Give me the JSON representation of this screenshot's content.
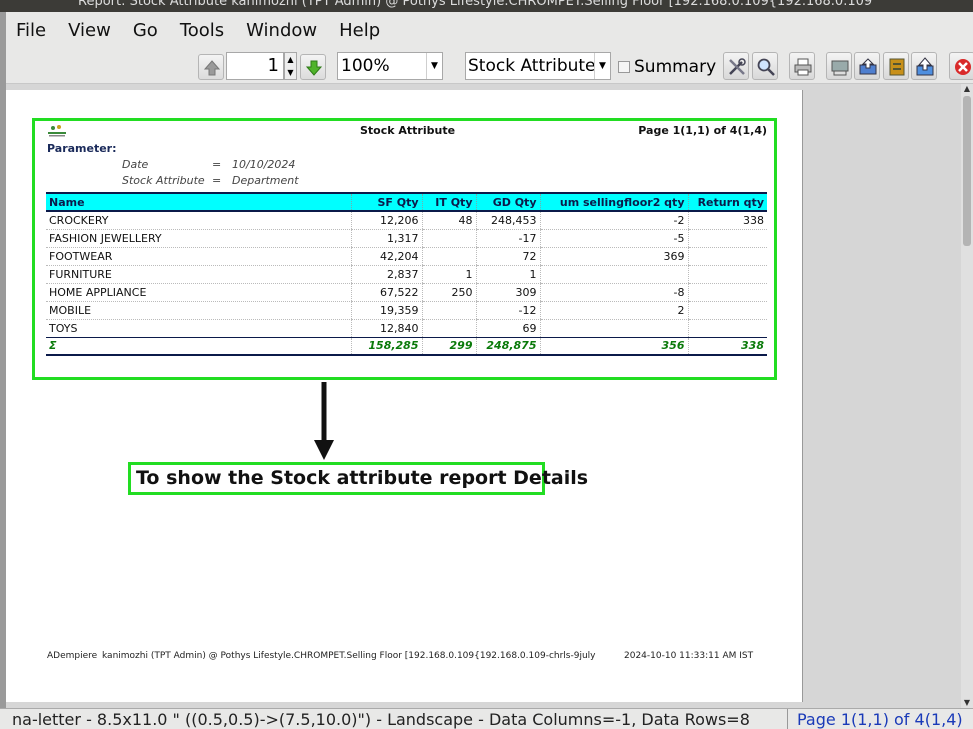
{
  "window": {
    "title": "Report: Stock Attribute  kanimozhi (TPT Admin) @ Pothys Lifestyle.CHROMPET.Selling Floor [192.168.0.109{192.168.0.109"
  },
  "menu": [
    "File",
    "View",
    "Go",
    "Tools",
    "Window",
    "Help"
  ],
  "toolbar": {
    "page_value": "1",
    "zoom_value": "100%",
    "report_select": "Stock Attribute",
    "summary_label": "Summary",
    "summary_checked": false
  },
  "report": {
    "title": "Stock Attribute",
    "page_info": "Page 1(1,1) of 4(1,4)",
    "parameter_heading": "Parameter:",
    "params": [
      {
        "key": "Date",
        "eq": "=",
        "value": "10/10/2024"
      },
      {
        "key": "Stock Attribute",
        "eq": "=",
        "value": "Department"
      }
    ],
    "columns": [
      "Name",
      "SF Qty",
      "IT Qty",
      "GD Qty",
      "um sellingfloor2 qty",
      "Return qty"
    ],
    "rows": [
      [
        "CROCKERY",
        "12,206",
        "48",
        "248,453",
        "-2",
        "338"
      ],
      [
        "FASHION JEWELLERY",
        "1,317",
        "",
        "-17",
        "-5",
        ""
      ],
      [
        "FOOTWEAR",
        "42,204",
        "",
        "72",
        "369",
        ""
      ],
      [
        "FURNITURE",
        "2,837",
        "1",
        "1",
        "",
        ""
      ],
      [
        "HOME APPLIANCE",
        "67,522",
        "250",
        "309",
        "-8",
        ""
      ],
      [
        "MOBILE",
        "19,359",
        "",
        "-12",
        "2",
        ""
      ],
      [
        "TOYS",
        "12,840",
        "",
        "69",
        "",
        ""
      ]
    ],
    "totals": [
      "Σ",
      "158,285",
      "299",
      "248,875",
      "356",
      "338"
    ],
    "footer_left": "ADempiere",
    "footer_mid": "kanimozhi (TPT Admin) @ Pothys Lifestyle.CHROMPET.Selling Floor [192.168.0.109{192.168.0.109-chrls-9july",
    "footer_right": "2024-10-10 11:33:11 AM IST"
  },
  "callout": {
    "text": "To show the Stock attribute report Details",
    "border_color": "#22dd22"
  },
  "status": {
    "left": "na-letter - 8.5x11.0 \" ((0.5,0.5)->(7.5,10.0)\") - Landscape - Data Columns=-1, Data Rows=8",
    "right": "Page 1(1,1) of 4(1,4)"
  },
  "colors": {
    "header_bg": "#00ffff",
    "total_text": "#0a7a0a",
    "highlight": "#22dd22"
  }
}
